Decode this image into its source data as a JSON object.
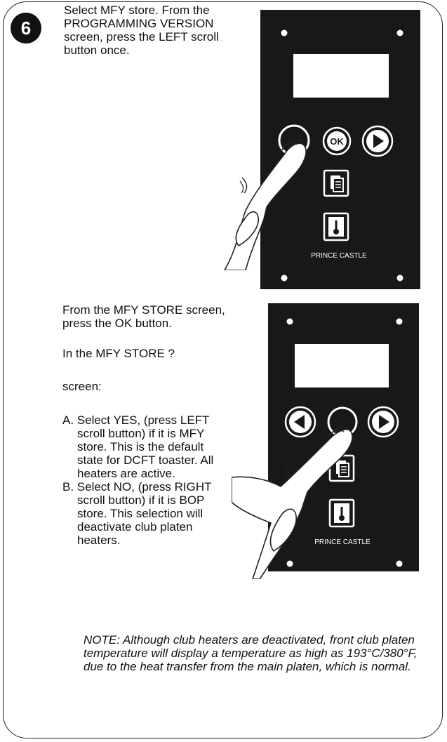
{
  "step": {
    "number": "6"
  },
  "section1": {
    "instruction": "Select MFY store. From the PROGRAMMING VERSION screen, press the LEFT scroll button once."
  },
  "section2": {
    "instruction": "From the MFY STORE screen, press the OK button.",
    "line_a": "In the MFY STORE ?",
    "line_b": "screen:",
    "options": [
      "A. Select YES, (press LEFT scroll button) if it is MFY store. This is the default state for DCFT toaster. All heaters are active.",
      "B. Select NO, (press RIGHT scroll button) if it is BOP store. This selection will deactivate club platen heaters."
    ],
    "note": "NOTE: Although club heaters are deactivated, front club platen temperature will display a temperature as high as 193°C/380°F, due to the heat transfer from the main platen, which is normal."
  },
  "panel": {
    "ok_label": "OK",
    "brand": "PRINCE CASTLE"
  },
  "colors": {
    "panel_bg": "#181818",
    "panel_fg": "#ffffff",
    "hand_fill": "#ffffff",
    "outline": "#222222"
  }
}
